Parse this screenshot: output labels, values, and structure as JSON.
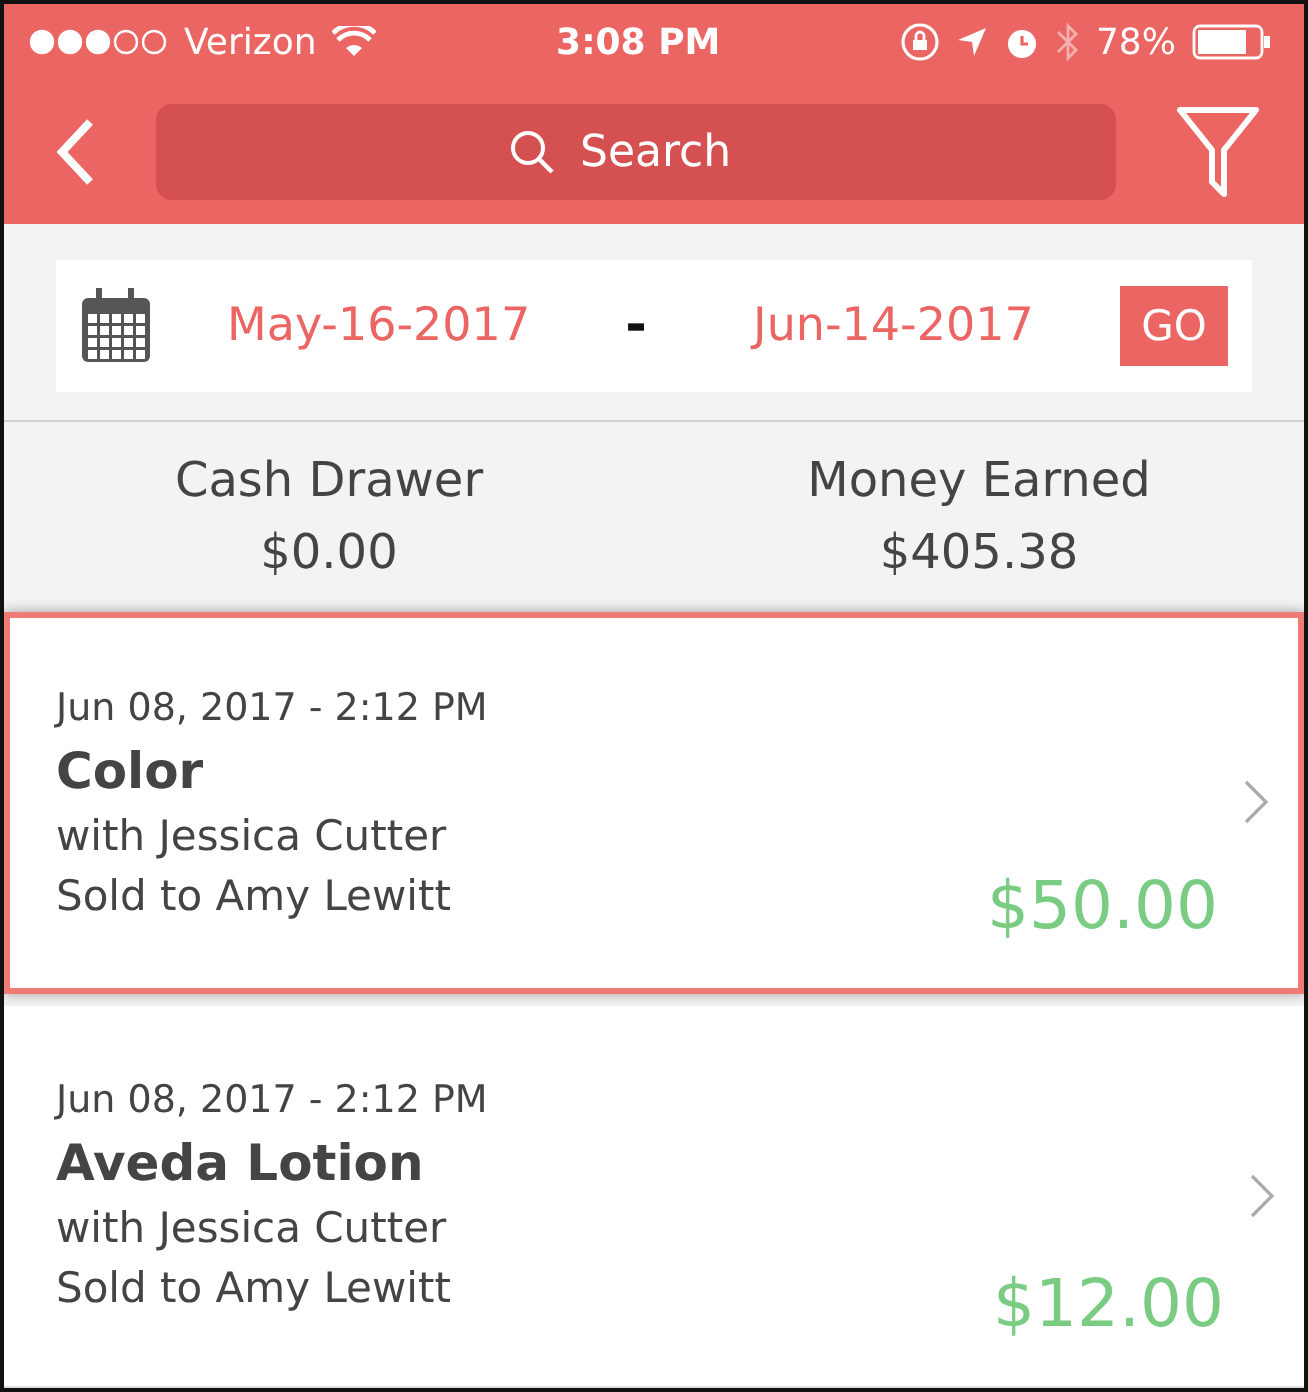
{
  "status_bar": {
    "carrier": "Verizon",
    "time": "3:08 PM",
    "battery": "78%"
  },
  "nav": {
    "search": {
      "placeholder": "Search"
    }
  },
  "date_range": {
    "from": "May-16-2017",
    "separator": "-",
    "to": "Jun-14-2017",
    "go": "GO"
  },
  "summary": [
    {
      "label": "Cash Drawer",
      "value": "$0.00"
    },
    {
      "label": "Money Earned",
      "value": "$405.38"
    }
  ],
  "transactions": [
    {
      "date": "Jun 08, 2017 - 2:12 PM",
      "title": "Color",
      "staff": "with Jessica Cutter",
      "customer": "Sold to Amy Lewitt",
      "amount": "$50.00",
      "selected": true
    },
    {
      "date": "Jun 08, 2017 - 2:12 PM",
      "title": "Aveda Lotion",
      "staff": "with Jessica Cutter",
      "customer": "Sold to Amy Lewitt",
      "amount": "$12.00",
      "selected": false
    }
  ]
}
